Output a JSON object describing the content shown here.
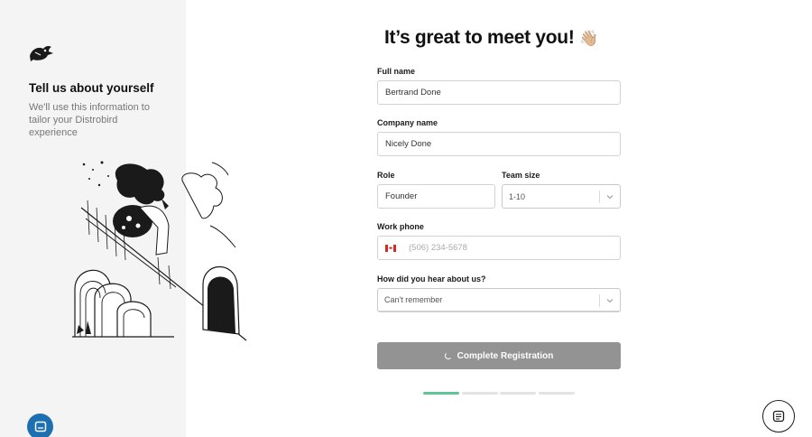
{
  "sidebar": {
    "title": "Tell us about yourself",
    "description": "We'll use this information to tailor your Distrobird experience"
  },
  "main": {
    "title": "It’s great to meet you!",
    "title_emoji": "👋🏼"
  },
  "form": {
    "full_name": {
      "label": "Full name",
      "value": "Bertrand Done"
    },
    "company_name": {
      "label": "Company name",
      "value": "Nicely Done"
    },
    "role": {
      "label": "Role",
      "value": "Founder"
    },
    "team_size": {
      "label": "Team size",
      "value": "1-10"
    },
    "work_phone": {
      "label": "Work phone",
      "placeholder": "(506) 234-5678",
      "country": "CA"
    },
    "heard_about": {
      "label": "How did you hear about us?",
      "value": "Can't remember"
    },
    "submit_label": "Complete Registration"
  },
  "progress": {
    "total_steps": 4,
    "current_step": 1,
    "active_color": "#5fc592",
    "inactive_color": "#e3e3e3"
  },
  "colors": {
    "sidebar_bg": "#f4f4f4",
    "button_disabled": "#939393",
    "chat_bubble": "#1c6fb0"
  },
  "icons": {
    "logo": "distrobird-logo-icon",
    "chat": "chat-bubble-icon",
    "help": "help-chat-icon",
    "spinner": "loading-spinner-icon",
    "chevron": "chevron-down-icon",
    "flag": "canada-flag-icon"
  }
}
